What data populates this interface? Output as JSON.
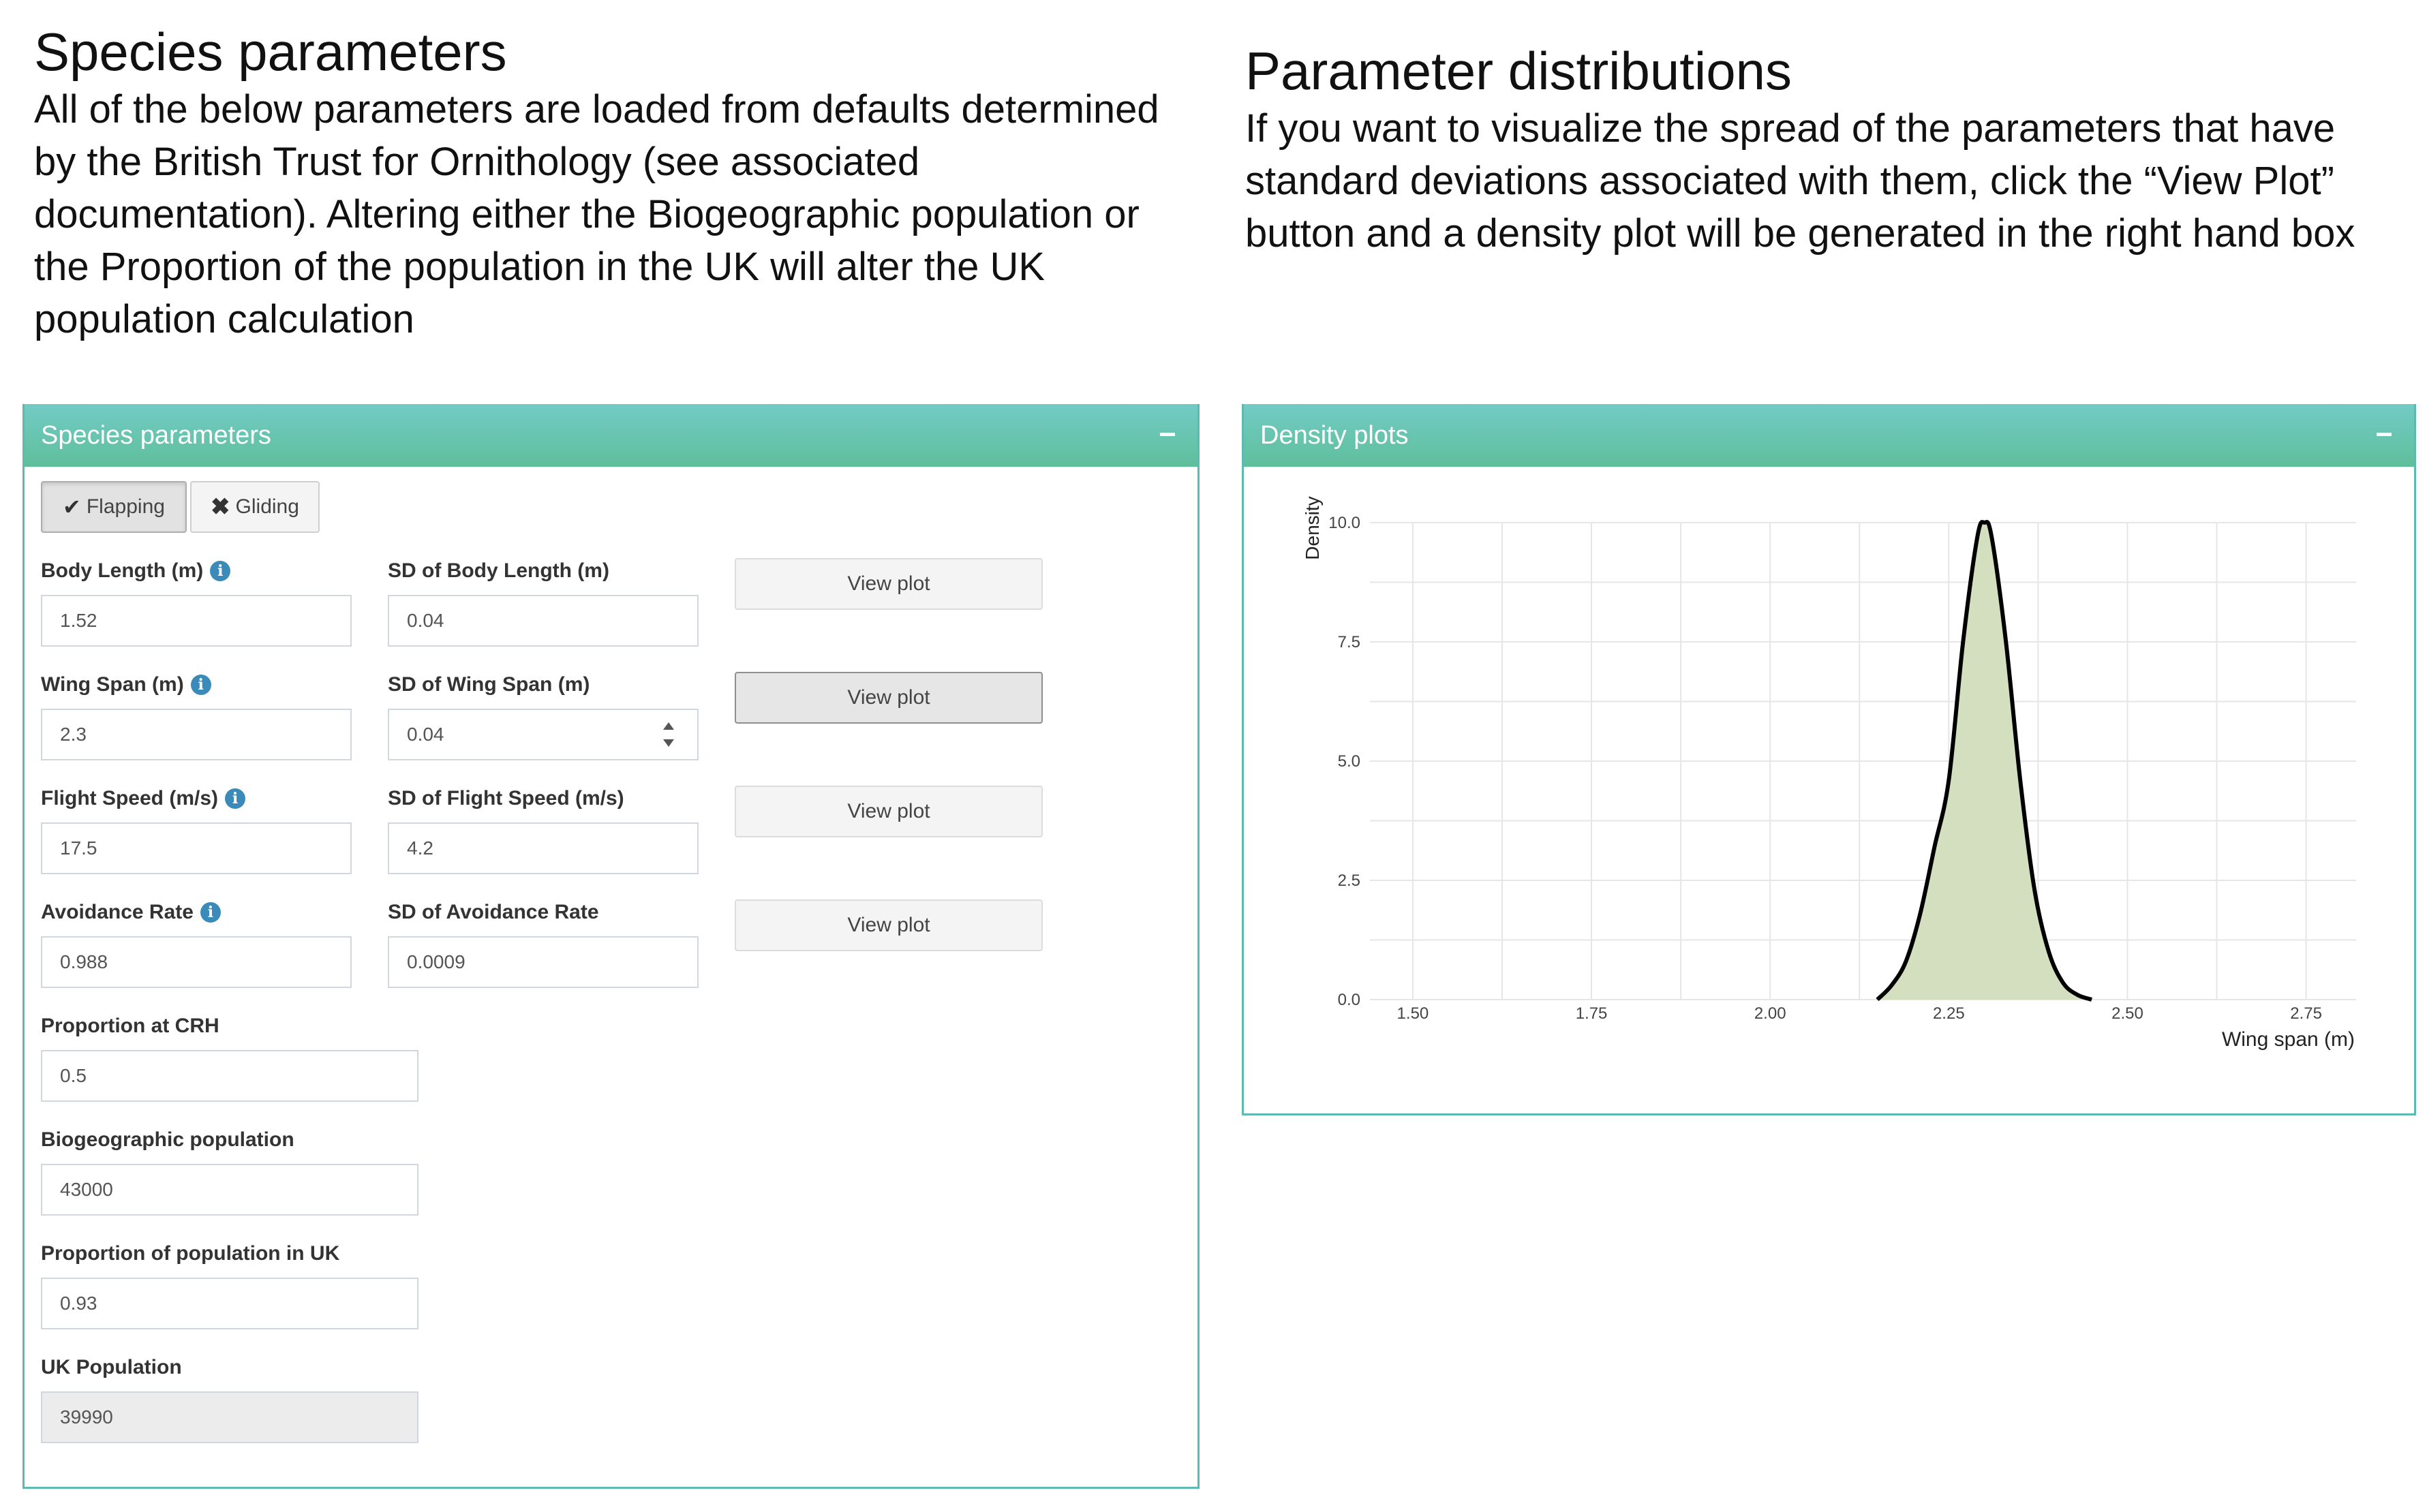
{
  "intro_left": {
    "title": "Species parameters",
    "text": "All of the below parameters are loaded from defaults determined by the British Trust for Ornithology (see associated documentation). Altering either the Biogeographic population or the Proportion of the population in the UK will alter the UK population calculation"
  },
  "intro_right": {
    "title": "Parameter distributions",
    "text": "If you want to visualize the spread of the parameters that have standard deviations associated with them, click the “View Plot” button and a density plot will be generated in the right hand box"
  },
  "species_box": {
    "title": "Species parameters",
    "flight_modes": [
      {
        "label": "Flapping",
        "selected": true,
        "icon": "check-icon"
      },
      {
        "label": "Gliding",
        "selected": false,
        "icon": "cross-icon"
      }
    ],
    "fields": {
      "body_length": {
        "label": "Body Length (m)",
        "value": "1.52"
      },
      "sd_body_length": {
        "label": "SD of Body Length (m)",
        "value": "0.04"
      },
      "wing_span": {
        "label": "Wing Span (m)",
        "value": "2.3"
      },
      "sd_wing_span": {
        "label": "SD of Wing Span (m)",
        "value": "0.04"
      },
      "flight_speed": {
        "label": "Flight Speed (m/s)",
        "value": "17.5"
      },
      "sd_flight_speed": {
        "label": "SD of Flight Speed (m/s)",
        "value": "4.2"
      },
      "avoidance_rate": {
        "label": "Avoidance Rate",
        "value": "0.988"
      },
      "sd_avoidance_rate": {
        "label": "SD of Avoidance Rate",
        "value": "0.0009"
      },
      "proportion_crh": {
        "label": "Proportion at CRH",
        "value": "0.5"
      },
      "biogeographic_population": {
        "label": "Biogeographic population",
        "value": "43000"
      },
      "proportion_uk": {
        "label": "Proportion of population in UK",
        "value": "0.93"
      },
      "uk_population": {
        "label": "UK Population",
        "value": "39990"
      }
    },
    "view_plot_label": "View plot"
  },
  "density_box": {
    "title": "Density plots"
  },
  "chart_data": {
    "type": "area",
    "title": "",
    "xlabel": "Wing span (m)",
    "ylabel": "Density",
    "xlim": [
      1.44,
      2.82
    ],
    "ylim": [
      0,
      10.0
    ],
    "x_ticks": [
      "1.50",
      "1.75",
      "2.00",
      "2.25",
      "2.50",
      "2.75"
    ],
    "y_ticks": [
      "0.0",
      "2.5",
      "5.0",
      "7.5",
      "10.0"
    ],
    "grid": true,
    "legend": "none",
    "series": [
      {
        "x": [
          2.15,
          2.17,
          2.19,
          2.21,
          2.23,
          2.25,
          2.27,
          2.29,
          2.3,
          2.31,
          2.33,
          2.35,
          2.37,
          2.39,
          2.41,
          2.43,
          2.45
        ],
        "values": [
          0.0,
          0.3,
          0.8,
          1.8,
          3.2,
          4.6,
          7.5,
          9.7,
          10.0,
          9.7,
          7.5,
          4.6,
          2.3,
          1.0,
          0.35,
          0.1,
          0.0
        ]
      }
    ],
    "fill_color": "#d3dfbf",
    "line_color": "#000000"
  }
}
